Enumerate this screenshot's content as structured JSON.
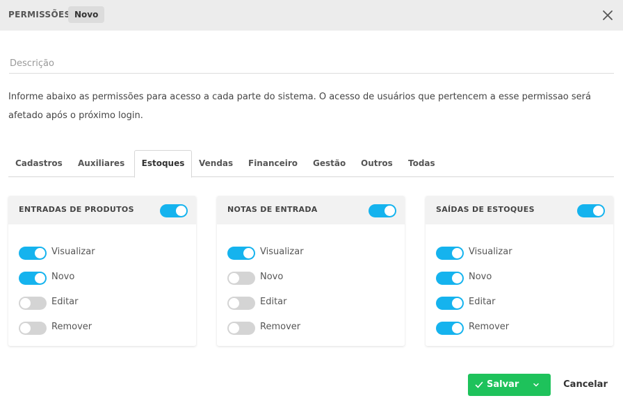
{
  "header": {
    "title": "PERMISSÕES",
    "badge": "Novo"
  },
  "description": {
    "placeholder": "Descrição",
    "value": ""
  },
  "info_text": "Informe abaixo as permissões para acesso a cada parte do sistema. O acesso de usuários que pertencem a esse permissao será afetado após o próximo login.",
  "tabs": [
    {
      "label": "Cadastros",
      "active": false
    },
    {
      "label": "Auxiliares",
      "active": false
    },
    {
      "label": "Estoques",
      "active": true
    },
    {
      "label": "Vendas",
      "active": false
    },
    {
      "label": "Financeiro",
      "active": false
    },
    {
      "label": "Gestão",
      "active": false
    },
    {
      "label": "Outros",
      "active": false
    },
    {
      "label": "Todas",
      "active": false
    }
  ],
  "cards": [
    {
      "title": "ENTRADAS DE PRODUTOS",
      "enabled": true,
      "permissions": [
        {
          "label": "Visualizar",
          "on": true
        },
        {
          "label": "Novo",
          "on": true
        },
        {
          "label": "Editar",
          "on": false
        },
        {
          "label": "Remover",
          "on": false
        }
      ]
    },
    {
      "title": "NOTAS DE ENTRADA",
      "enabled": true,
      "permissions": [
        {
          "label": "Visualizar",
          "on": true
        },
        {
          "label": "Novo",
          "on": false
        },
        {
          "label": "Editar",
          "on": false
        },
        {
          "label": "Remover",
          "on": false
        }
      ]
    },
    {
      "title": "SAÍDAS DE ESTOQUES",
      "enabled": true,
      "permissions": [
        {
          "label": "Visualizar",
          "on": true
        },
        {
          "label": "Novo",
          "on": true
        },
        {
          "label": "Editar",
          "on": true
        },
        {
          "label": "Remover",
          "on": true
        }
      ]
    }
  ],
  "footer": {
    "save_label": "Salvar",
    "cancel_label": "Cancelar"
  },
  "colors": {
    "toggle_on": "#15b3ee",
    "toggle_off": "#d4d4d4",
    "save": "#1ec25b"
  },
  "icons": {
    "close": "close-icon",
    "check": "check-icon",
    "dropdown": "chevron-down-icon"
  }
}
